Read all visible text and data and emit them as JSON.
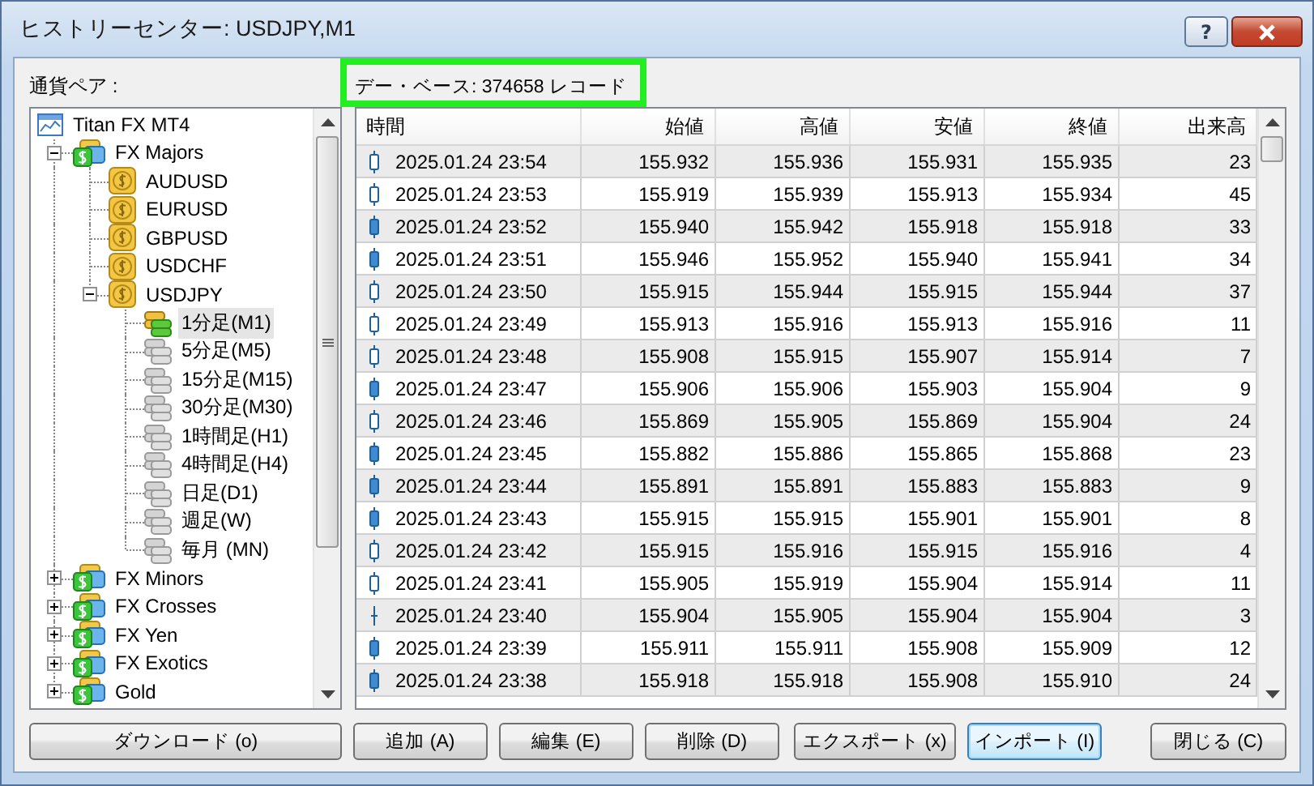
{
  "window": {
    "title": "ヒストリーセンター: USDJPY,M1",
    "help_button": "?"
  },
  "pairs_label": "通貨ペア :",
  "database_label": "デー・ベース: 374658 レコード",
  "tree": [
    {
      "label": "Titan FX MT4",
      "kind": "root",
      "children": [
        {
          "label": "FX Majors",
          "kind": "group",
          "expanded": true,
          "children": [
            {
              "label": "AUDUSD",
              "kind": "symbol"
            },
            {
              "label": "EURUSD",
              "kind": "symbol"
            },
            {
              "label": "GBPUSD",
              "kind": "symbol"
            },
            {
              "label": "USDCHF",
              "kind": "symbol"
            },
            {
              "label": "USDJPY",
              "kind": "symbol",
              "expanded": true,
              "children": [
                {
                  "label": "1分足(M1)",
                  "kind": "timeframe",
                  "selected": true
                },
                {
                  "label": "5分足(M5)",
                  "kind": "timeframe",
                  "selected": false
                },
                {
                  "label": "15分足(M15)",
                  "kind": "timeframe",
                  "selected": false
                },
                {
                  "label": "30分足(M30)",
                  "kind": "timeframe",
                  "selected": false
                },
                {
                  "label": "1時間足(H1)",
                  "kind": "timeframe",
                  "selected": false
                },
                {
                  "label": "4時間足(H4)",
                  "kind": "timeframe",
                  "selected": false
                },
                {
                  "label": "日足(D1)",
                  "kind": "timeframe",
                  "selected": false
                },
                {
                  "label": "週足(W)",
                  "kind": "timeframe",
                  "selected": false
                },
                {
                  "label": "毎月 (MN)",
                  "kind": "timeframe",
                  "selected": false
                }
              ]
            }
          ]
        },
        {
          "label": "FX Minors",
          "kind": "group",
          "expanded": false
        },
        {
          "label": "FX Crosses",
          "kind": "group",
          "expanded": false
        },
        {
          "label": "FX Yen",
          "kind": "group",
          "expanded": false
        },
        {
          "label": "FX Exotics",
          "kind": "group",
          "expanded": false
        },
        {
          "label": "Gold",
          "kind": "group",
          "expanded": false
        }
      ]
    }
  ],
  "table": {
    "columns": [
      "時間",
      "始値",
      "高値",
      "安値",
      "終値",
      "出来高"
    ],
    "rows": [
      {
        "kind": "up",
        "cells": [
          "2025.01.24 23:54",
          "155.932",
          "155.936",
          "155.931",
          "155.935",
          "23"
        ]
      },
      {
        "kind": "up",
        "cells": [
          "2025.01.24 23:53",
          "155.919",
          "155.939",
          "155.913",
          "155.934",
          "45"
        ]
      },
      {
        "kind": "down",
        "cells": [
          "2025.01.24 23:52",
          "155.940",
          "155.942",
          "155.918",
          "155.918",
          "33"
        ]
      },
      {
        "kind": "down",
        "cells": [
          "2025.01.24 23:51",
          "155.946",
          "155.952",
          "155.940",
          "155.941",
          "34"
        ]
      },
      {
        "kind": "up",
        "cells": [
          "2025.01.24 23:50",
          "155.915",
          "155.944",
          "155.915",
          "155.944",
          "37"
        ]
      },
      {
        "kind": "up",
        "cells": [
          "2025.01.24 23:49",
          "155.913",
          "155.916",
          "155.913",
          "155.916",
          "11"
        ]
      },
      {
        "kind": "up",
        "cells": [
          "2025.01.24 23:48",
          "155.908",
          "155.915",
          "155.907",
          "155.914",
          "7"
        ]
      },
      {
        "kind": "down",
        "cells": [
          "2025.01.24 23:47",
          "155.906",
          "155.906",
          "155.903",
          "155.904",
          "9"
        ]
      },
      {
        "kind": "up",
        "cells": [
          "2025.01.24 23:46",
          "155.869",
          "155.905",
          "155.869",
          "155.904",
          "24"
        ]
      },
      {
        "kind": "down",
        "cells": [
          "2025.01.24 23:45",
          "155.882",
          "155.886",
          "155.865",
          "155.868",
          "23"
        ]
      },
      {
        "kind": "down",
        "cells": [
          "2025.01.24 23:44",
          "155.891",
          "155.891",
          "155.883",
          "155.883",
          "9"
        ]
      },
      {
        "kind": "down",
        "cells": [
          "2025.01.24 23:43",
          "155.915",
          "155.915",
          "155.901",
          "155.901",
          "8"
        ]
      },
      {
        "kind": "up",
        "cells": [
          "2025.01.24 23:42",
          "155.915",
          "155.916",
          "155.915",
          "155.916",
          "4"
        ]
      },
      {
        "kind": "up",
        "cells": [
          "2025.01.24 23:41",
          "155.905",
          "155.919",
          "155.904",
          "155.914",
          "11"
        ]
      },
      {
        "kind": "doji",
        "cells": [
          "2025.01.24 23:40",
          "155.904",
          "155.905",
          "155.904",
          "155.904",
          "3"
        ]
      },
      {
        "kind": "down",
        "cells": [
          "2025.01.24 23:39",
          "155.911",
          "155.911",
          "155.908",
          "155.909",
          "12"
        ]
      },
      {
        "kind": "down",
        "cells": [
          "2025.01.24 23:38",
          "155.918",
          "155.918",
          "155.908",
          "155.910",
          "24"
        ]
      }
    ]
  },
  "buttons": [
    {
      "label": "ダウンロード (o)",
      "focused": false
    },
    {
      "label": "追加 (A)",
      "focused": false
    },
    {
      "label": "編集 (E)",
      "focused": false
    },
    {
      "label": "削除 (D)",
      "focused": false
    },
    {
      "label": "エクスポート (x)",
      "focused": false
    },
    {
      "label": "インポート (I)",
      "focused": true
    },
    {
      "label": "閉じる (C)",
      "focused": false
    }
  ]
}
